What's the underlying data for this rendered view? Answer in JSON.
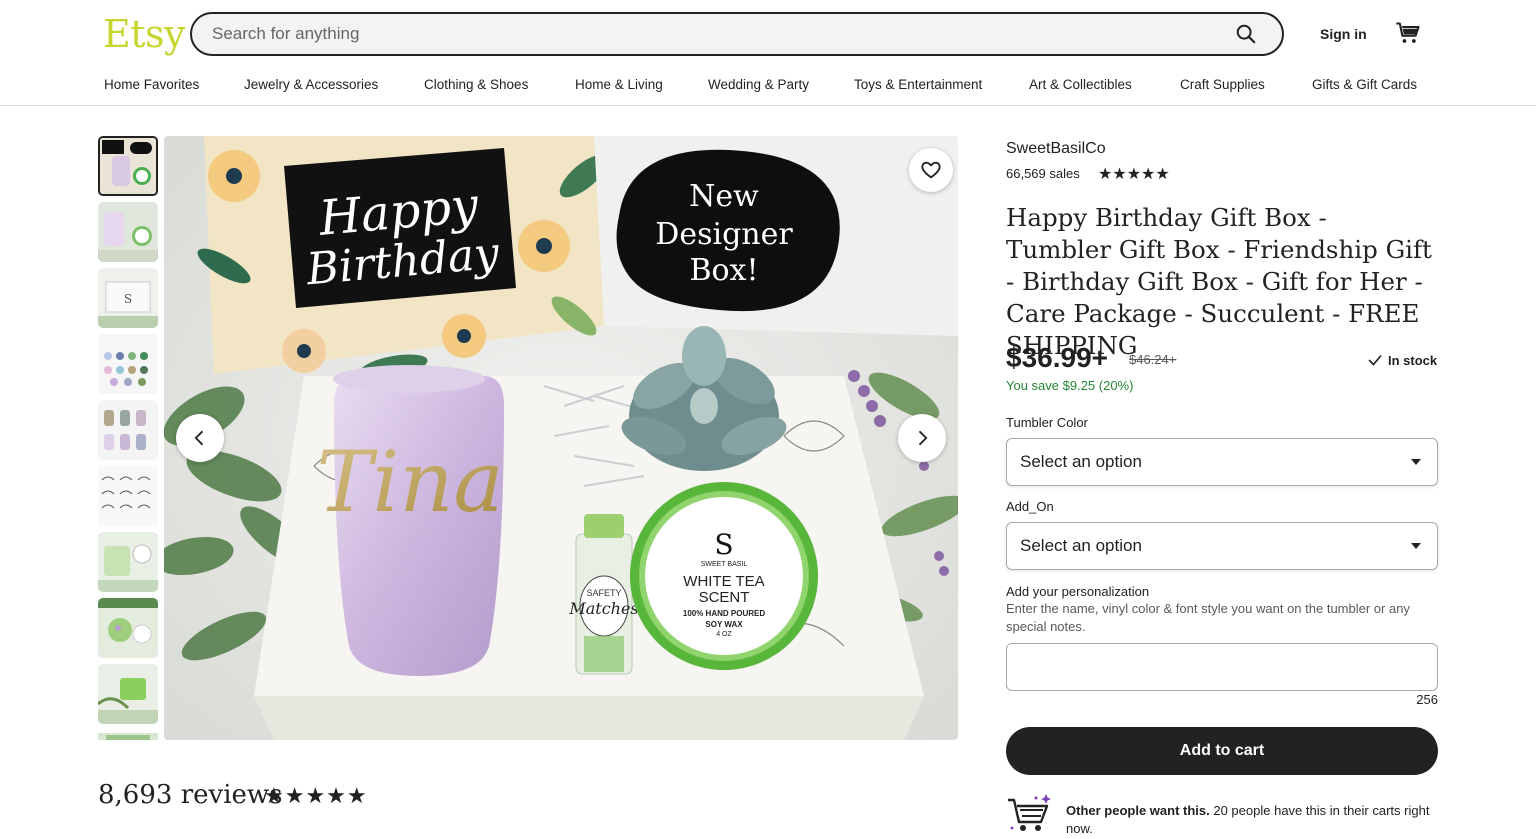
{
  "header": {
    "logo": "Etsy",
    "search_placeholder": "Search for anything",
    "signin": "Sign in"
  },
  "nav": [
    "Home Favorites",
    "Jewelry & Accessories",
    "Clothing & Shoes",
    "Home & Living",
    "Wedding & Party",
    "Toys & Entertainment",
    "Art & Collectibles",
    "Craft Supplies",
    "Gifts & Gift Cards"
  ],
  "image": {
    "card_text": "Happy Birthday",
    "bubble_text": "New Designer Box!",
    "tumbler_name": "Tina",
    "candle_brand": "SWEET BASIL",
    "candle_text1": "WHITE TEA",
    "candle_text2": "SCENT",
    "candle_text3": "100% HAND POURED",
    "candle_text4": "SOY WAX",
    "candle_text5": "4 OZ",
    "matches": "Matches"
  },
  "product": {
    "shop": "SweetBasilCo",
    "sales": "66,569 sales",
    "shop_stars": "★★★★★",
    "title": "Happy Birthday Gift Box - Tumbler Gift Box - Friendship Gift - Birthday Gift Box - Gift for Her - Care Package - Succulent - FREE SHIPPING",
    "price": "$36.99+",
    "old_price": "$46.24+",
    "stock": "In stock",
    "save": "You save $9.25 (20%)",
    "option1_label": "Tumbler Color",
    "option1_value": "Select an option",
    "option2_label": "Add_On",
    "option2_value": "Select an option",
    "perso_label": "Add your personalization",
    "perso_desc": "Enter the name, vinyl color & font style you want on the tumbler or any special notes.",
    "perso_counter": "256",
    "add_to_cart": "Add to cart",
    "other_bold": "Other people want this.",
    "other_rest": " 20 people have this in their carts right now."
  },
  "reviews": {
    "count": "8,693 reviews",
    "stars": "★★★★★"
  }
}
